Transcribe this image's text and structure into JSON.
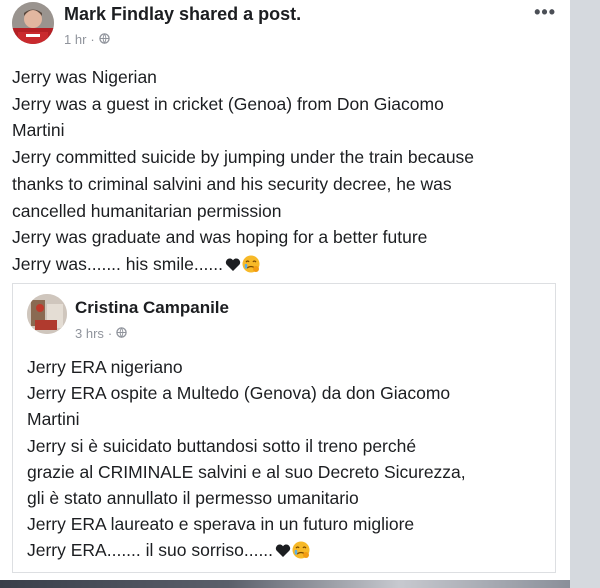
{
  "post": {
    "author": "Mark Findlay",
    "action": "shared a post.",
    "time": "1 hr",
    "separator": "·",
    "more_label": "•••",
    "lines": [
      "Jerry was Nigerian",
      "Jerry was a guest in cricket (Genoa) from Don Giacomo",
      "Martini",
      "Jerry committed suicide by jumping under the train because",
      "thanks to criminal salvini and his security decree, he was",
      "cancelled humanitarian permission",
      "Jerry was graduate and was hoping for a better future",
      "Jerry was....... his smile......"
    ]
  },
  "shared": {
    "author": "Cristina Campanile",
    "time": "3 hrs",
    "separator": "·",
    "lines": [
      "Jerry ERA nigeriano",
      "Jerry ERA ospite a Multedo (Genova) da don Giacomo",
      "Martini",
      "Jerry si è suicidato buttandosi sotto il treno  perché",
      "grazie al CRIMINALE  salvini e al suo Decreto Sicurezza,",
      "gli è stato annullato il permesso umanitario",
      "Jerry ERA laureato e sperava in un futuro migliore",
      "Jerry ERA....... il suo sorriso......"
    ]
  },
  "icons": {
    "privacy": "globe-icon",
    "heart": "black-heart-icon",
    "face": "crying-face-icon"
  },
  "colors": {
    "text": "#1c1e21",
    "meta": "#90949c",
    "border": "#dddfe2",
    "heart": "#1c1e21",
    "emoji": "#f7b928"
  }
}
